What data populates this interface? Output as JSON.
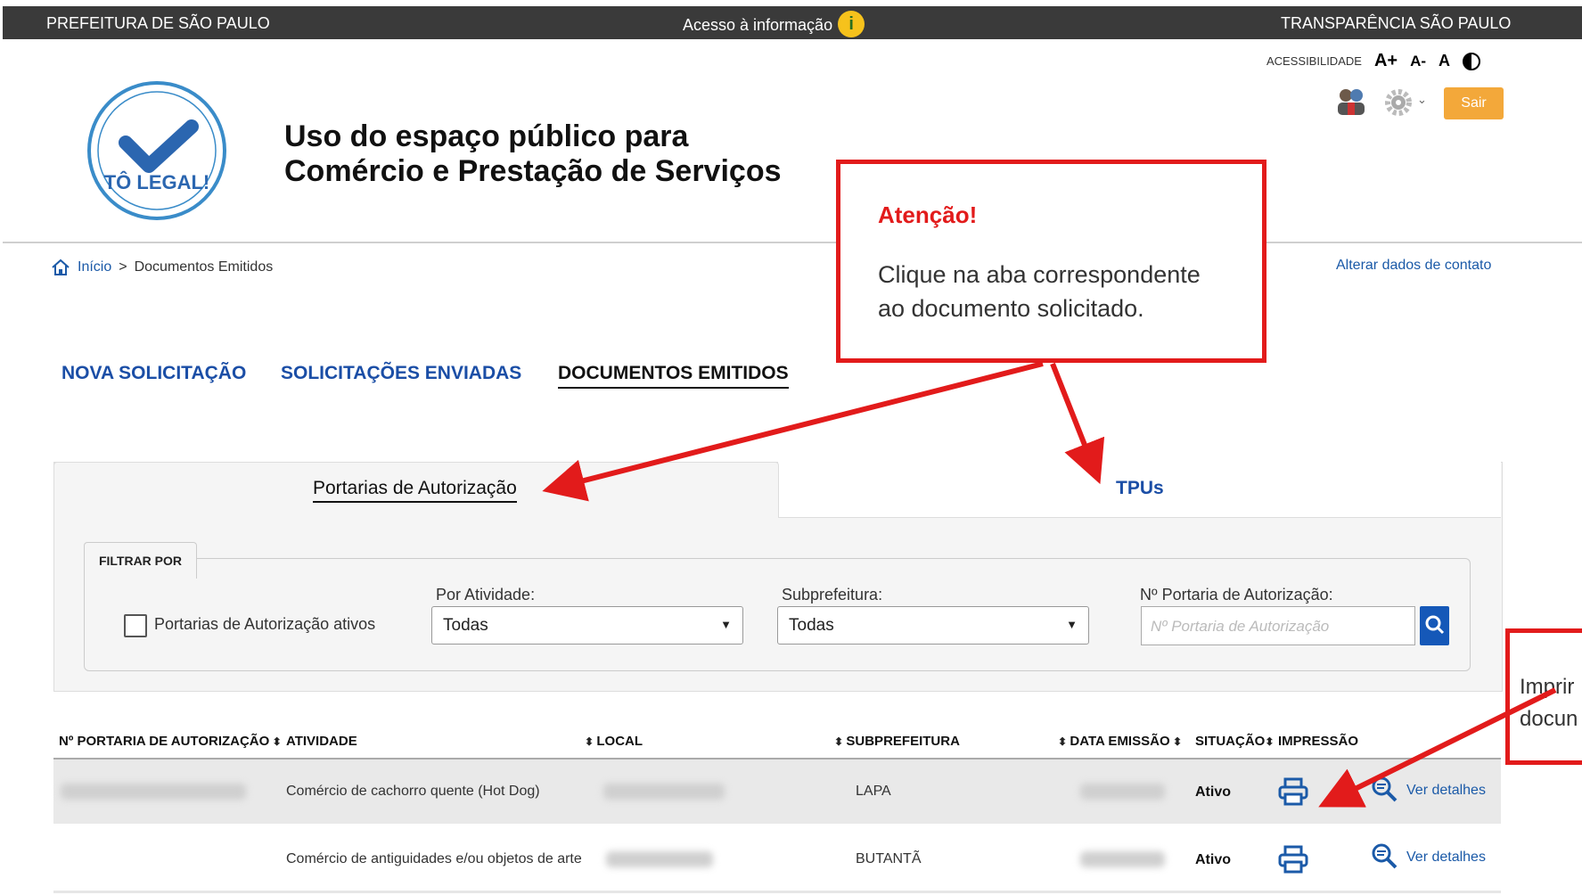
{
  "topbar": {
    "left": "PREFEITURA DE SÃO PAULO",
    "center": "Acesso à informação",
    "right": "TRANSPARÊNCIA SÃO PAULO"
  },
  "accessibility": {
    "label": "ACESSIBILIDADE",
    "increase": "A+",
    "decrease": "A-",
    "normal": "A"
  },
  "header": {
    "sair_label": "Sair",
    "title_line1": "Uso do espaço público para",
    "title_line2": "Comércio e Prestação de Serviços",
    "logo_text": "TÔ LEGAL!"
  },
  "breadcrumb": {
    "home": "Início",
    "separator": ">",
    "current": "Documentos Emitidos"
  },
  "contact_link": "Alterar dados de contato",
  "nav": {
    "tab1": "NOVA SOLICITAÇÃO",
    "tab2": "SOLICITAÇÕES ENVIADAS",
    "tab3": "DOCUMENTOS EMITIDOS"
  },
  "doc_tabs": {
    "portarias": "Portarias de Autorização",
    "tpus": "TPUs"
  },
  "filter": {
    "legend": "FILTRAR POR",
    "checkbox_label": "Portarias de Autorização ativos",
    "atividade_label": "Por Atividade:",
    "atividade_value": "Todas",
    "subprefeitura_label": "Subprefeitura:",
    "subprefeitura_value": "Todas",
    "portaria_label": "Nº Portaria de Autorização:",
    "portaria_placeholder": "Nº Portaria de Autorização"
  },
  "table": {
    "headers": {
      "portaria": "Nº PORTARIA DE AUTORIZAÇÃO",
      "atividade": "ATIVIDADE",
      "local": "LOCAL",
      "subprefeitura": "SUBPREFEITURA",
      "data": "DATA EMISSÃO",
      "situacao": "SITUAÇÃO",
      "impressao": "IMPRESSÃO"
    },
    "rows": [
      {
        "atividade": "Comércio de cachorro quente (Hot Dog)",
        "subprefeitura": "LAPA",
        "situacao": "Ativo",
        "detalhes": "Ver detalhes"
      },
      {
        "atividade": "Comércio de antiguidades e/ou objetos de arte",
        "subprefeitura": "BUTANTÃ",
        "situacao": "Ativo",
        "detalhes": "Ver detalhes"
      }
    ]
  },
  "callouts": {
    "attention_title": "Atenção!",
    "attention_line1": "Clique na aba correspondente",
    "attention_line2": "ao documento solicitado.",
    "print_line1": "Imprir",
    "print_line2": "docun"
  },
  "colors": {
    "accent_red": "#e21b1b",
    "link_blue": "#1b5aa8",
    "sair_orange": "#f3a83a"
  }
}
